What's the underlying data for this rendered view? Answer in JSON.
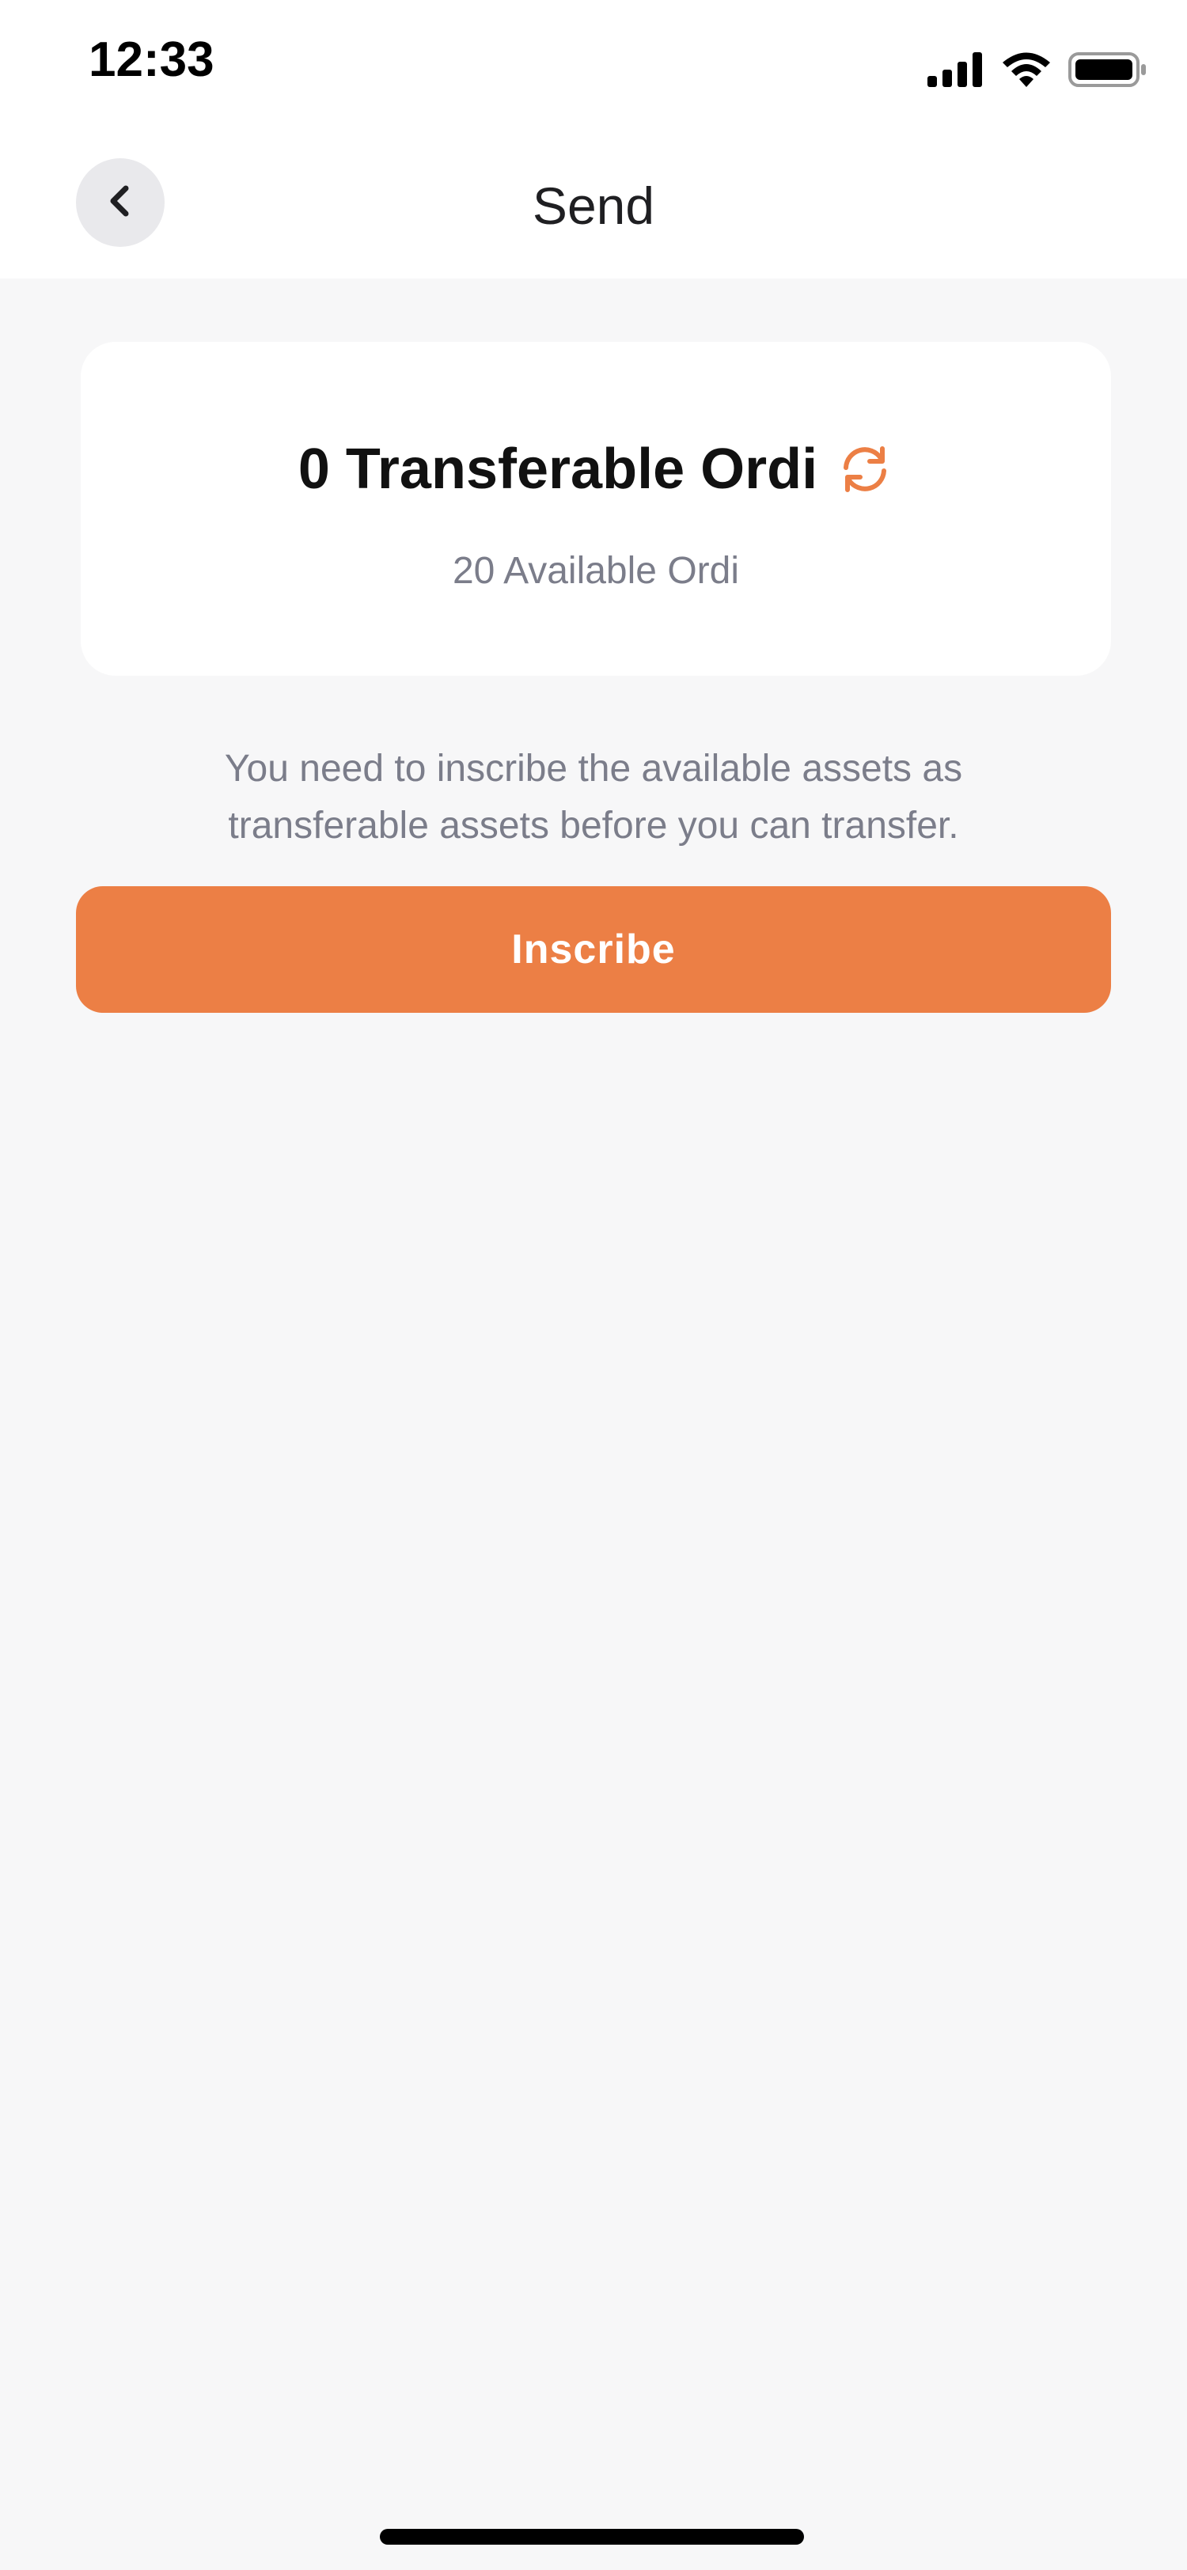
{
  "status_bar": {
    "time": "12:33",
    "icons": [
      "signal-icon",
      "wifi-icon",
      "battery-icon"
    ]
  },
  "nav": {
    "title": "Send",
    "back_icon": "chevron-left-icon"
  },
  "balance": {
    "transferable": "0 Transferable Ordi",
    "available": "20 Available Ordi",
    "refresh_icon": "refresh-icon"
  },
  "hint": {
    "line1": "You need to inscribe the available assets as",
    "line2": "transferable assets before you can transfer."
  },
  "actions": {
    "inscribe_label": "Inscribe"
  },
  "colors": {
    "accent": "#ec7f45",
    "background": "#f7f7f8",
    "card": "#ffffff",
    "secondary_text": "#7b7d8a"
  }
}
